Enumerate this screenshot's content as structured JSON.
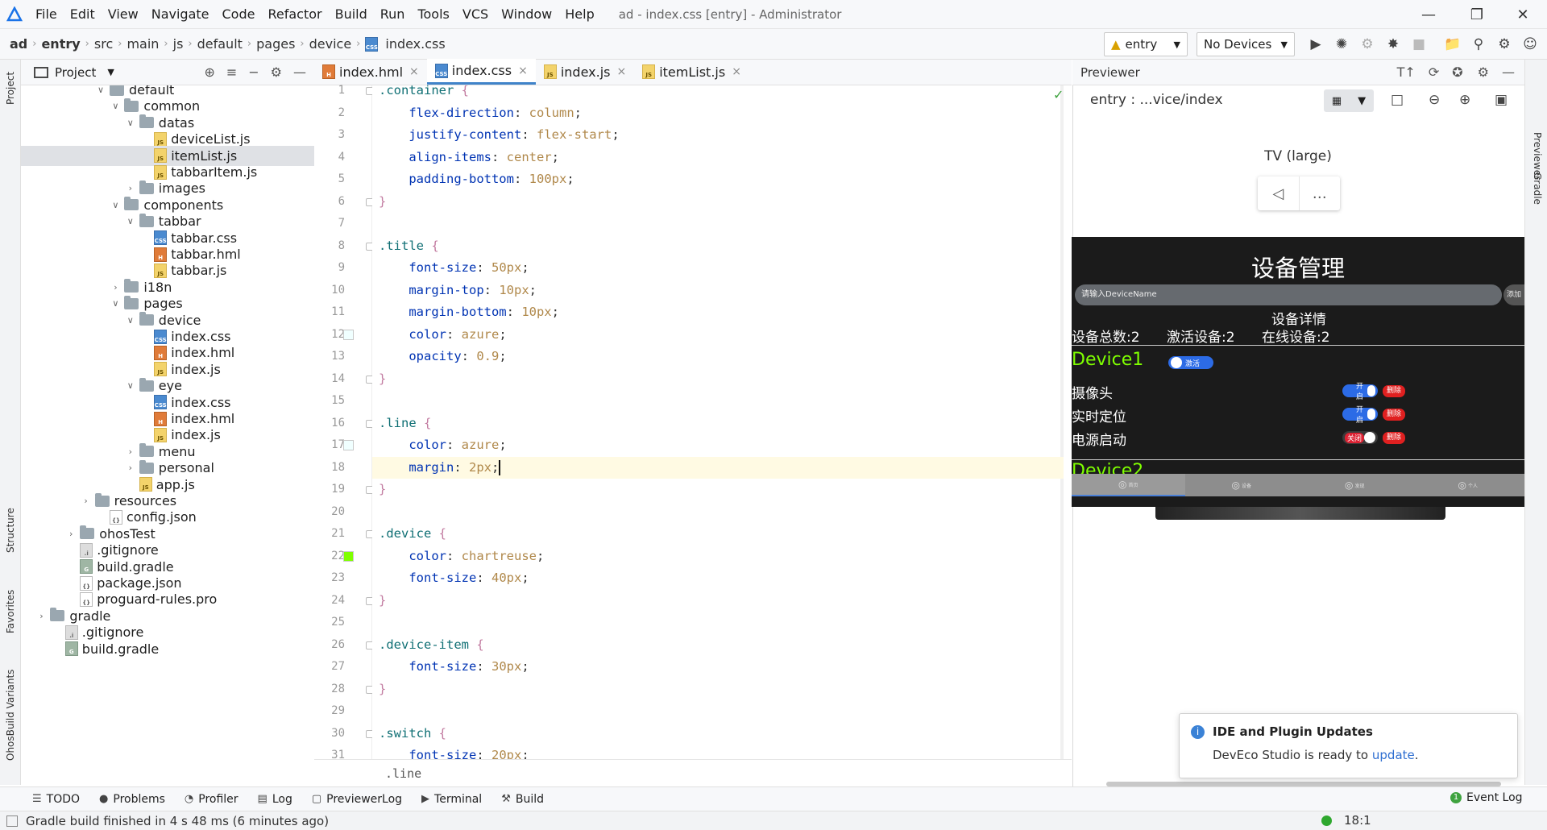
{
  "menu": {
    "items": [
      "File",
      "Edit",
      "View",
      "Navigate",
      "Code",
      "Refactor",
      "Build",
      "Run",
      "Tools",
      "VCS",
      "Window",
      "Help"
    ],
    "window_title": "ad - index.css [entry] - Administrator"
  },
  "nav": {
    "breadcrumbs": [
      "ad",
      "entry",
      "src",
      "main",
      "js",
      "default",
      "pages",
      "device",
      "index.css"
    ],
    "module_selector": "entry",
    "device_selector": "No Devices"
  },
  "project": {
    "title": "Project",
    "tree": [
      {
        "label": "default",
        "type": "folder",
        "depth": 5,
        "expanded": true
      },
      {
        "label": "common",
        "type": "folder",
        "depth": 6,
        "expanded": true
      },
      {
        "label": "datas",
        "type": "folder",
        "depth": 7,
        "expanded": true
      },
      {
        "label": "deviceList.js",
        "type": "js",
        "depth": 8
      },
      {
        "label": "itemList.js",
        "type": "js",
        "depth": 8,
        "selected": true
      },
      {
        "label": "tabbarItem.js",
        "type": "js",
        "depth": 8
      },
      {
        "label": "images",
        "type": "folder",
        "depth": 7,
        "expanded": false
      },
      {
        "label": "components",
        "type": "folder",
        "depth": 6,
        "expanded": true
      },
      {
        "label": "tabbar",
        "type": "folder",
        "depth": 7,
        "expanded": true
      },
      {
        "label": "tabbar.css",
        "type": "css",
        "depth": 8
      },
      {
        "label": "tabbar.hml",
        "type": "hml",
        "depth": 8
      },
      {
        "label": "tabbar.js",
        "type": "js",
        "depth": 8
      },
      {
        "label": "i18n",
        "type": "folder",
        "depth": 6,
        "expanded": false
      },
      {
        "label": "pages",
        "type": "folder",
        "depth": 6,
        "expanded": true
      },
      {
        "label": "device",
        "type": "folder",
        "depth": 7,
        "expanded": true
      },
      {
        "label": "index.css",
        "type": "css",
        "depth": 8
      },
      {
        "label": "index.hml",
        "type": "hml",
        "depth": 8
      },
      {
        "label": "index.js",
        "type": "js",
        "depth": 8
      },
      {
        "label": "eye",
        "type": "folder",
        "depth": 7,
        "expanded": true
      },
      {
        "label": "index.css",
        "type": "css",
        "depth": 8
      },
      {
        "label": "index.hml",
        "type": "hml",
        "depth": 8
      },
      {
        "label": "index.js",
        "type": "js",
        "depth": 8
      },
      {
        "label": "menu",
        "type": "folder",
        "depth": 7,
        "expanded": false
      },
      {
        "label": "personal",
        "type": "folder",
        "depth": 7,
        "expanded": false
      },
      {
        "label": "app.js",
        "type": "js",
        "depth": 7
      },
      {
        "label": "resources",
        "type": "folder",
        "depth": 4,
        "expanded": false
      },
      {
        "label": "config.json",
        "type": "json",
        "depth": 5
      },
      {
        "label": "ohosTest",
        "type": "folder",
        "depth": 3,
        "expanded": false
      },
      {
        "label": ".gitignore",
        "type": "git",
        "depth": 3
      },
      {
        "label": "build.gradle",
        "type": "gradle",
        "depth": 3
      },
      {
        "label": "package.json",
        "type": "json",
        "depth": 3
      },
      {
        "label": "proguard-rules.pro",
        "type": "json",
        "depth": 3
      },
      {
        "label": "gradle",
        "type": "folder",
        "depth": 1,
        "expanded": false
      },
      {
        "label": ".gitignore",
        "type": "git",
        "depth": 2
      },
      {
        "label": "build.gradle",
        "type": "gradle",
        "depth": 2
      }
    ]
  },
  "editor": {
    "tabs": [
      {
        "label": "index.hml",
        "type": "hml",
        "active": false
      },
      {
        "label": "index.css",
        "type": "css",
        "active": true
      },
      {
        "label": "index.js",
        "type": "js",
        "active": false
      },
      {
        "label": "itemList.js",
        "type": "js",
        "active": false
      }
    ],
    "current_line": 18,
    "lines": [
      [
        {
          "t": ".container",
          "c": "sel"
        },
        {
          "t": " {",
          "c": "brace"
        }
      ],
      [
        {
          "t": "    flex-direction",
          "c": "prop"
        },
        {
          "t": ": ",
          "c": "punct"
        },
        {
          "t": "column",
          "c": "val"
        },
        {
          "t": ";",
          "c": "punct"
        }
      ],
      [
        {
          "t": "    justify-content",
          "c": "prop"
        },
        {
          "t": ": ",
          "c": "punct"
        },
        {
          "t": "flex-start",
          "c": "val"
        },
        {
          "t": ";",
          "c": "punct"
        }
      ],
      [
        {
          "t": "    align-items",
          "c": "prop"
        },
        {
          "t": ": ",
          "c": "punct"
        },
        {
          "t": "center",
          "c": "val"
        },
        {
          "t": ";",
          "c": "punct"
        }
      ],
      [
        {
          "t": "    padding-bottom",
          "c": "prop"
        },
        {
          "t": ": ",
          "c": "punct"
        },
        {
          "t": "100px",
          "c": "val"
        },
        {
          "t": ";",
          "c": "punct"
        }
      ],
      [
        {
          "t": "}",
          "c": "brace"
        }
      ],
      [],
      [
        {
          "t": ".title",
          "c": "sel"
        },
        {
          "t": " {",
          "c": "brace"
        }
      ],
      [
        {
          "t": "    font-size",
          "c": "prop"
        },
        {
          "t": ": ",
          "c": "punct"
        },
        {
          "t": "50px",
          "c": "val"
        },
        {
          "t": ";",
          "c": "punct"
        }
      ],
      [
        {
          "t": "    margin-top",
          "c": "prop"
        },
        {
          "t": ": ",
          "c": "punct"
        },
        {
          "t": "10px",
          "c": "val"
        },
        {
          "t": ";",
          "c": "punct"
        }
      ],
      [
        {
          "t": "    margin-bottom",
          "c": "prop"
        },
        {
          "t": ": ",
          "c": "punct"
        },
        {
          "t": "10px",
          "c": "val"
        },
        {
          "t": ";",
          "c": "punct"
        }
      ],
      [
        {
          "t": "    color",
          "c": "prop"
        },
        {
          "t": ": ",
          "c": "punct"
        },
        {
          "t": "azure",
          "c": "val"
        },
        {
          "t": ";",
          "c": "punct"
        }
      ],
      [
        {
          "t": "    opacity",
          "c": "prop"
        },
        {
          "t": ": ",
          "c": "punct"
        },
        {
          "t": "0.9",
          "c": "val"
        },
        {
          "t": ";",
          "c": "punct"
        }
      ],
      [
        {
          "t": "}",
          "c": "brace"
        }
      ],
      [],
      [
        {
          "t": ".line",
          "c": "sel"
        },
        {
          "t": " {",
          "c": "brace"
        }
      ],
      [
        {
          "t": "    color",
          "c": "prop"
        },
        {
          "t": ": ",
          "c": "punct"
        },
        {
          "t": "azure",
          "c": "val"
        },
        {
          "t": ";",
          "c": "punct"
        }
      ],
      [
        {
          "t": "    margin",
          "c": "prop"
        },
        {
          "t": ": ",
          "c": "punct"
        },
        {
          "t": "2px",
          "c": "val"
        },
        {
          "t": ";",
          "c": "punct"
        }
      ],
      [
        {
          "t": "}",
          "c": "brace"
        }
      ],
      [],
      [
        {
          "t": ".device",
          "c": "sel"
        },
        {
          "t": " {",
          "c": "brace"
        }
      ],
      [
        {
          "t": "    color",
          "c": "prop"
        },
        {
          "t": ": ",
          "c": "punct"
        },
        {
          "t": "chartreuse",
          "c": "val"
        },
        {
          "t": ";",
          "c": "punct"
        }
      ],
      [
        {
          "t": "    font-size",
          "c": "prop"
        },
        {
          "t": ": ",
          "c": "punct"
        },
        {
          "t": "40px",
          "c": "val"
        },
        {
          "t": ";",
          "c": "punct"
        }
      ],
      [
        {
          "t": "}",
          "c": "brace"
        }
      ],
      [],
      [
        {
          "t": ".device-item",
          "c": "sel"
        },
        {
          "t": " {",
          "c": "brace"
        }
      ],
      [
        {
          "t": "    font-size",
          "c": "prop"
        },
        {
          "t": ": ",
          "c": "punct"
        },
        {
          "t": "30px",
          "c": "val"
        },
        {
          "t": ";",
          "c": "punct"
        }
      ],
      [
        {
          "t": "}",
          "c": "brace"
        }
      ],
      [],
      [
        {
          "t": ".switch",
          "c": "sel"
        },
        {
          "t": " {",
          "c": "brace"
        }
      ],
      [
        {
          "t": "    font-size",
          "c": "prop"
        },
        {
          "t": ": ",
          "c": "punct"
        },
        {
          "t": "20px",
          "c": "val"
        },
        {
          "t": ";",
          "c": "punct"
        }
      ]
    ],
    "swatches": [
      {
        "line": 12,
        "color": "#f0ffff"
      },
      {
        "line": 17,
        "color": "#f0ffff"
      },
      {
        "line": 22,
        "color": "#7fff00"
      }
    ],
    "bottom_breadcrumb": ".line"
  },
  "previewer": {
    "title": "Previewer",
    "route": "entry : ...vice/index",
    "device_label": "TV (large)",
    "app": {
      "title": "设备管理",
      "search_placeholder": "请输入DeviceName",
      "add_label": "添加",
      "total": "设备总数:2",
      "activated": "激活设备:2",
      "detail": "设备详情",
      "online": "在线设备:2",
      "device_name": "Device1",
      "device_status": "激活",
      "device2_partial": "Device2",
      "items": [
        {
          "name": "摄像头",
          "switch": "开启",
          "on": true,
          "delete": "删除"
        },
        {
          "name": "实时定位",
          "switch": "开启",
          "on": true,
          "delete": "删除"
        },
        {
          "name": "电源启动",
          "switch": "关闭",
          "on": false,
          "delete": "删除"
        }
      ],
      "tabbar": [
        "首页",
        "设备",
        "发现",
        "个人"
      ]
    }
  },
  "notification": {
    "title": "IDE and Plugin Updates",
    "body": "DevEco Studio is ready to",
    "link": "update",
    "period": "."
  },
  "bottom_tools": [
    "TODO",
    "Problems",
    "Profiler",
    "Log",
    "PreviewerLog",
    "Terminal",
    "Build"
  ],
  "event_log": {
    "count": "1",
    "label": "Event Log"
  },
  "status": {
    "message": "Gradle build finished in 4 s 48 ms (6 minutes ago)",
    "position": "18:1"
  },
  "side_labels": {
    "project": "Project",
    "structure": "Structure",
    "favorites": "Favorites",
    "build_variants": "OhosBuild Variants",
    "previewer": "Previewer",
    "gradle": "Gradle"
  }
}
